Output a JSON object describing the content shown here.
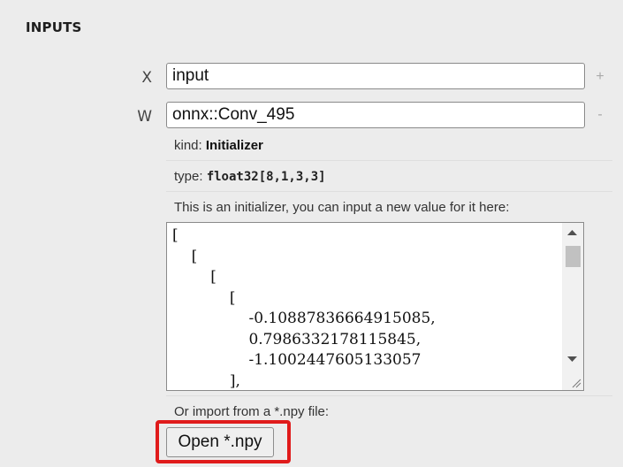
{
  "section": {
    "title": "INPUTS"
  },
  "inputs": [
    {
      "label": "X",
      "value": "input",
      "action_icon": "+"
    },
    {
      "label": "W",
      "value": "onnx::Conv_495",
      "action_icon": "-"
    }
  ],
  "details": {
    "kind_label": "kind:",
    "kind_value": "Initializer",
    "type_label": "type:",
    "type_value": "float32[8,1,3,3]",
    "initializer_hint": "This is an initializer, you can input a new value for it here:",
    "textarea_value": "[\n    [\n        [\n            [\n                -0.10887836664915085,\n                0.7986332178115845,\n                -1.1002447605133057\n            ],\n            [",
    "import_hint": "Or import from a *.npy file:",
    "open_button": "Open *.npy"
  },
  "colors": {
    "highlight": "#e01b1b",
    "background": "#ececec"
  }
}
